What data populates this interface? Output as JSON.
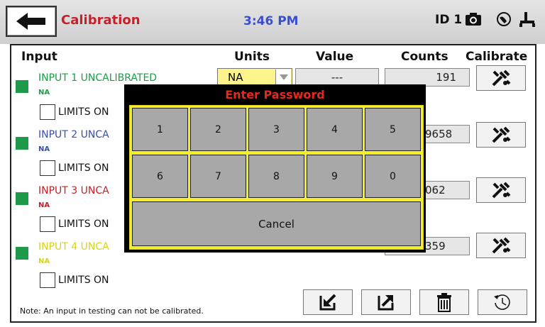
{
  "header": {
    "title": "Calibration",
    "time": "3:46 PM",
    "device_id": "ID 1",
    "icons": [
      "back-arrow-icon",
      "camera-icon",
      "network-icon",
      "usb-icon"
    ],
    "title_color": "#c8202a",
    "time_color": "#3a4fd0"
  },
  "columns": {
    "input": "Input",
    "units": "Units",
    "value": "Value",
    "counts": "Counts",
    "calibrate": "Calibrate"
  },
  "inputs": [
    {
      "name": "INPUT 1 UNCALIBRATED",
      "unit": "NA",
      "limits_label": "LIMITS ON",
      "color": "#1e9a4a",
      "units_value": "NA",
      "value": "---",
      "counts": "191"
    },
    {
      "name": "INPUT 2 UNCA",
      "unit": "NA",
      "limits_label": "LIMITS ON",
      "color": "#3b4fa8",
      "counts": "9658"
    },
    {
      "name": "INPUT 3 UNCA",
      "unit": "NA",
      "limits_label": "LIMITS ON",
      "color": "#c42127",
      "counts": "062"
    },
    {
      "name": "INPUT 4 UNCA",
      "unit": "NA",
      "limits_label": "LIMITS ON",
      "color": "#d8d21e",
      "counts": "359"
    }
  ],
  "note": "Note:  An input in testing can not be calibrated.",
  "toolbar_icons": [
    "import-icon",
    "export-icon",
    "trash-icon",
    "history-icon"
  ],
  "dialog": {
    "title": "Enter Password",
    "keys": [
      "1",
      "2",
      "3",
      "4",
      "5",
      "6",
      "7",
      "8",
      "9",
      "0"
    ],
    "cancel": "Cancel",
    "accent": "#f2ee2a"
  }
}
